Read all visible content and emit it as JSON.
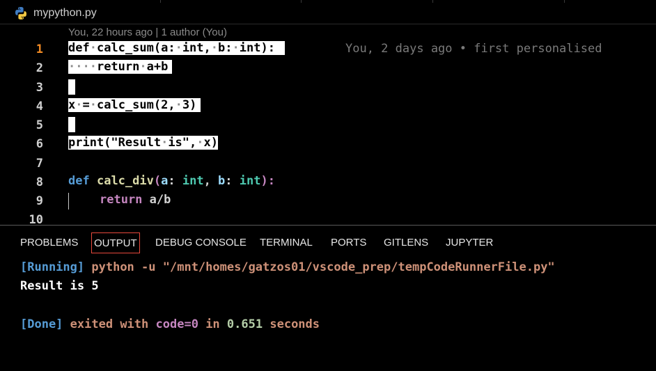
{
  "tab": {
    "filename": "mypython.py",
    "icon": "python-icon"
  },
  "editor": {
    "blame_header": "You, 22 hours ago | 1 author (You)",
    "inline_blame": "You, 2 days ago • first personalised",
    "line_numbers": [
      "1",
      "2",
      "3",
      "4",
      "5",
      "6",
      "7",
      "8",
      "9",
      "10"
    ],
    "active_line": "1",
    "lines": {
      "l1_def": "def",
      "l1_name": "calc_sum(a:",
      "l1_t1": "int,",
      "l1_b": "b:",
      "l1_t2": "int):",
      "l2_ret": "return",
      "l2_expr": "a+b",
      "l4_x": "x",
      "l4_eq": "=",
      "l4_call": "calc_sum(2,",
      "l4_arg": "3)",
      "l6_print": "print(\"Result",
      "l6_is": "is\",",
      "l6_x": "x)",
      "l8_def": "def",
      "l8_fn": "calc_div",
      "l8_p1": "(",
      "l8_a": "a",
      "l8_c1": ": ",
      "l8_int1": "int",
      "l8_c2": ", ",
      "l8_b": "b",
      "l8_c3": ": ",
      "l8_int2": "int",
      "l8_c4": "):",
      "l9_ret": "return",
      "l9_expr": "a/b"
    }
  },
  "panel": {
    "tabs": [
      "PROBLEMS",
      "OUTPUT",
      "DEBUG CONSOLE",
      "TERMINAL",
      "PORTS",
      "GITLENS",
      "JUPYTER"
    ],
    "active_tab": "OUTPUT",
    "output": {
      "running_tag": "[Running]",
      "running_cmd": "python -u",
      "running_path": "\"/mnt/homes/gatzos01/vscode_prep/tempCodeRunnerFile.py\"",
      "result_line": "Result is 5",
      "done_tag": "[Done]",
      "done_w1": "exited with",
      "done_code": "code=0",
      "done_in": "in",
      "done_time": "0.651",
      "done_secs": "seconds"
    }
  },
  "colors": {
    "accent_active_line": "#f08a24",
    "tab_focus_border": "#e9493c"
  }
}
